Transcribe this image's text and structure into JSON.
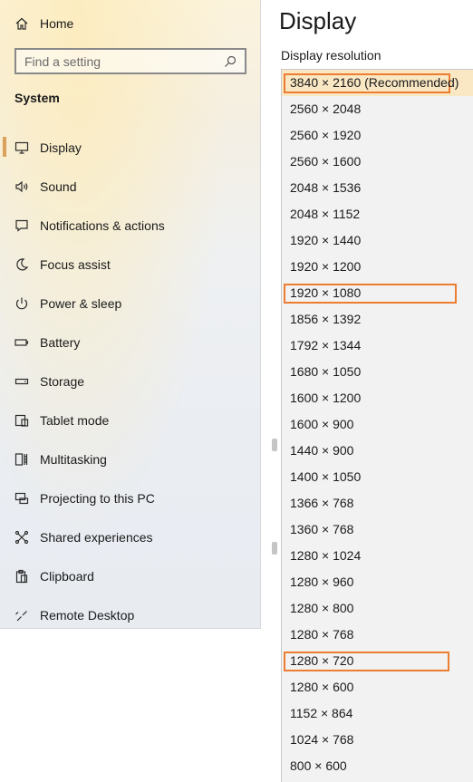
{
  "sidebar": {
    "home_label": "Home",
    "search_placeholder": "Find a setting",
    "section_title": "System",
    "items": [
      {
        "label": "Display",
        "icon": "monitor-icon",
        "active": true
      },
      {
        "label": "Sound",
        "icon": "speaker-icon",
        "active": false
      },
      {
        "label": "Notifications & actions",
        "icon": "notifications-icon",
        "active": false
      },
      {
        "label": "Focus assist",
        "icon": "moon-icon",
        "active": false
      },
      {
        "label": "Power & sleep",
        "icon": "power-icon",
        "active": false
      },
      {
        "label": "Battery",
        "icon": "battery-icon",
        "active": false
      },
      {
        "label": "Storage",
        "icon": "storage-icon",
        "active": false
      },
      {
        "label": "Tablet mode",
        "icon": "tablet-icon",
        "active": false
      },
      {
        "label": "Multitasking",
        "icon": "multitasking-icon",
        "active": false
      },
      {
        "label": "Projecting to this PC",
        "icon": "projecting-icon",
        "active": false
      },
      {
        "label": "Shared experiences",
        "icon": "shared-icon",
        "active": false
      },
      {
        "label": "Clipboard",
        "icon": "clipboard-icon",
        "active": false
      },
      {
        "label": "Remote Desktop",
        "icon": "remote-desktop-icon",
        "active": false
      }
    ]
  },
  "main": {
    "title": "Display",
    "resolution_label": "Display resolution"
  },
  "resolution_dropdown": {
    "selected_index": 0,
    "highlight_color": "#ed7d31",
    "options": [
      {
        "label": "3840 × 2160 (Recommended)",
        "boxed": true
      },
      {
        "label": "2560 × 2048",
        "boxed": false
      },
      {
        "label": "2560 × 1920",
        "boxed": false
      },
      {
        "label": "2560 × 1600",
        "boxed": false
      },
      {
        "label": "2048 × 1536",
        "boxed": false
      },
      {
        "label": "2048 × 1152",
        "boxed": false
      },
      {
        "label": "1920 × 1440",
        "boxed": false
      },
      {
        "label": "1920 × 1200",
        "boxed": false
      },
      {
        "label": "1920 × 1080",
        "boxed": true
      },
      {
        "label": "1856 × 1392",
        "boxed": false
      },
      {
        "label": "1792 × 1344",
        "boxed": false
      },
      {
        "label": "1680 × 1050",
        "boxed": false
      },
      {
        "label": "1600 × 1200",
        "boxed": false
      },
      {
        "label": "1600 × 900",
        "boxed": false
      },
      {
        "label": "1440 × 900",
        "boxed": false
      },
      {
        "label": "1400 × 1050",
        "boxed": false
      },
      {
        "label": "1366 × 768",
        "boxed": false
      },
      {
        "label": "1360 × 768",
        "boxed": false
      },
      {
        "label": "1280 × 1024",
        "boxed": false
      },
      {
        "label": "1280 × 960",
        "boxed": false
      },
      {
        "label": "1280 × 800",
        "boxed": false
      },
      {
        "label": "1280 × 768",
        "boxed": false
      },
      {
        "label": "1280 × 720",
        "boxed": true
      },
      {
        "label": "1280 × 600",
        "boxed": false
      },
      {
        "label": "1152 × 864",
        "boxed": false
      },
      {
        "label": "1024 × 768",
        "boxed": false
      },
      {
        "label": "800 × 600",
        "boxed": false
      }
    ]
  }
}
